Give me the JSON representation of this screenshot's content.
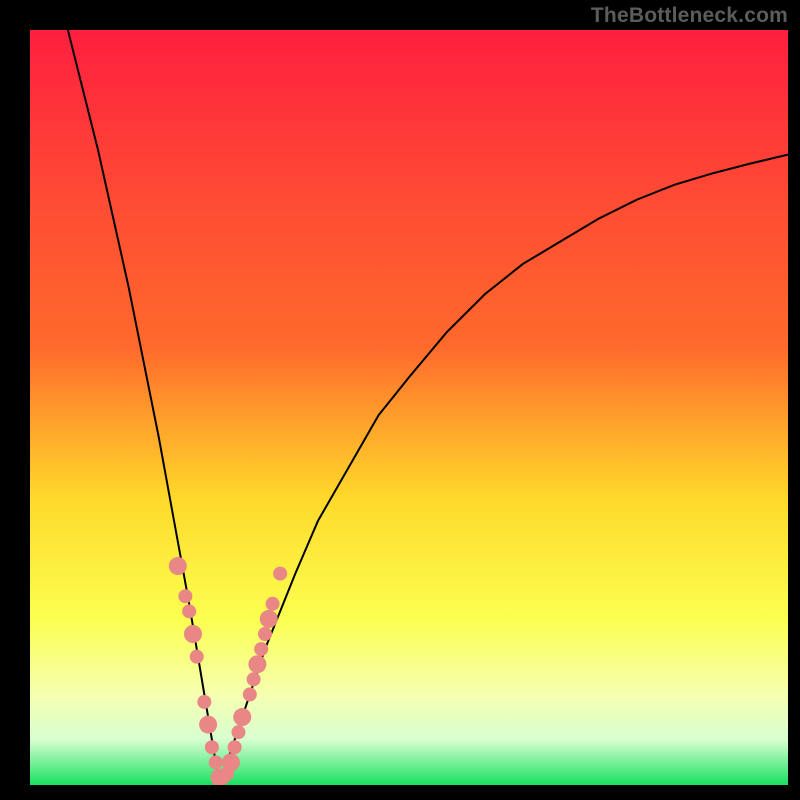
{
  "watermark": "TheBottleneck.com",
  "colors": {
    "frame": "#000000",
    "gradient_top": "#ff1f3f",
    "gradient_mid_upper": "#ff6a2c",
    "gradient_mid": "#ffd92a",
    "gradient_lower": "#fbff50",
    "gradient_pale": "#f6ffb0",
    "gradient_bottom": "#18e060",
    "curve": "#000000",
    "marker": "#e98686",
    "marker_edge": "#d46a6a"
  },
  "chart_data": {
    "type": "line",
    "title": "",
    "xlabel": "",
    "ylabel": "",
    "xlim": [
      0,
      100
    ],
    "ylim": [
      0,
      100
    ],
    "series": [
      {
        "name": "bottleneck-curve",
        "x_minimum": 25,
        "x": [
          5,
          7,
          9,
          11,
          13,
          15,
          17,
          19,
          21,
          23,
          25,
          27,
          29,
          31,
          33,
          35,
          38,
          42,
          46,
          50,
          55,
          60,
          65,
          70,
          75,
          80,
          85,
          90,
          95,
          100
        ],
        "y": [
          100,
          92,
          84,
          75,
          66,
          56,
          46,
          35,
          24,
          12,
          0,
          6,
          12,
          18,
          23,
          28,
          35,
          42,
          49,
          54,
          60,
          65,
          69,
          72,
          75,
          77.5,
          79.5,
          81,
          82.3,
          83.5
        ]
      }
    ],
    "markers": {
      "name": "highlight-points",
      "x": [
        19.5,
        20.5,
        21,
        21.5,
        22,
        23,
        23.5,
        24,
        24.5,
        25,
        25.5,
        26,
        26.5,
        27,
        27.5,
        28,
        29,
        29.5,
        30,
        30.5,
        31,
        31.5,
        32,
        33
      ],
      "y": [
        29,
        25,
        23,
        20,
        17,
        11,
        8,
        5,
        3,
        1,
        1,
        1.5,
        3,
        5,
        7,
        9,
        12,
        14,
        16,
        18,
        20,
        22,
        24,
        28
      ]
    }
  }
}
